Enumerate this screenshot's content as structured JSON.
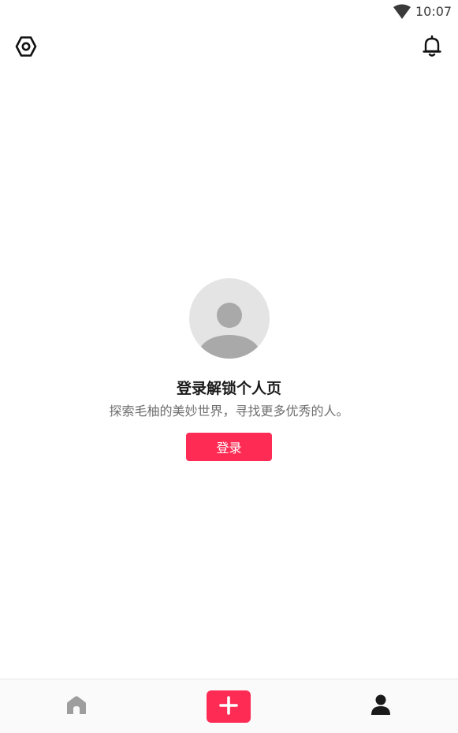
{
  "status_bar": {
    "time": "10:07",
    "wifi_icon": "wifi-icon"
  },
  "top_bar": {
    "settings_icon": "settings-icon",
    "notification_icon": "bell-icon"
  },
  "login_panel": {
    "avatar_icon": "default-avatar-icon",
    "headline": "登录解锁个人页",
    "subtitle": "探索毛柚的美妙世界，寻找更多优秀的人。",
    "login_button_label": "登录"
  },
  "bottom_nav": {
    "items": [
      {
        "icon": "home-icon"
      },
      {
        "icon": "plus-icon"
      },
      {
        "icon": "profile-icon"
      }
    ]
  },
  "colors": {
    "accent": "#fe2c55",
    "avatar_bg": "#e4e4e4",
    "avatar_figure": "#a9a9a9",
    "text_primary": "#1a1a1a",
    "text_secondary": "#6e6e6e"
  }
}
